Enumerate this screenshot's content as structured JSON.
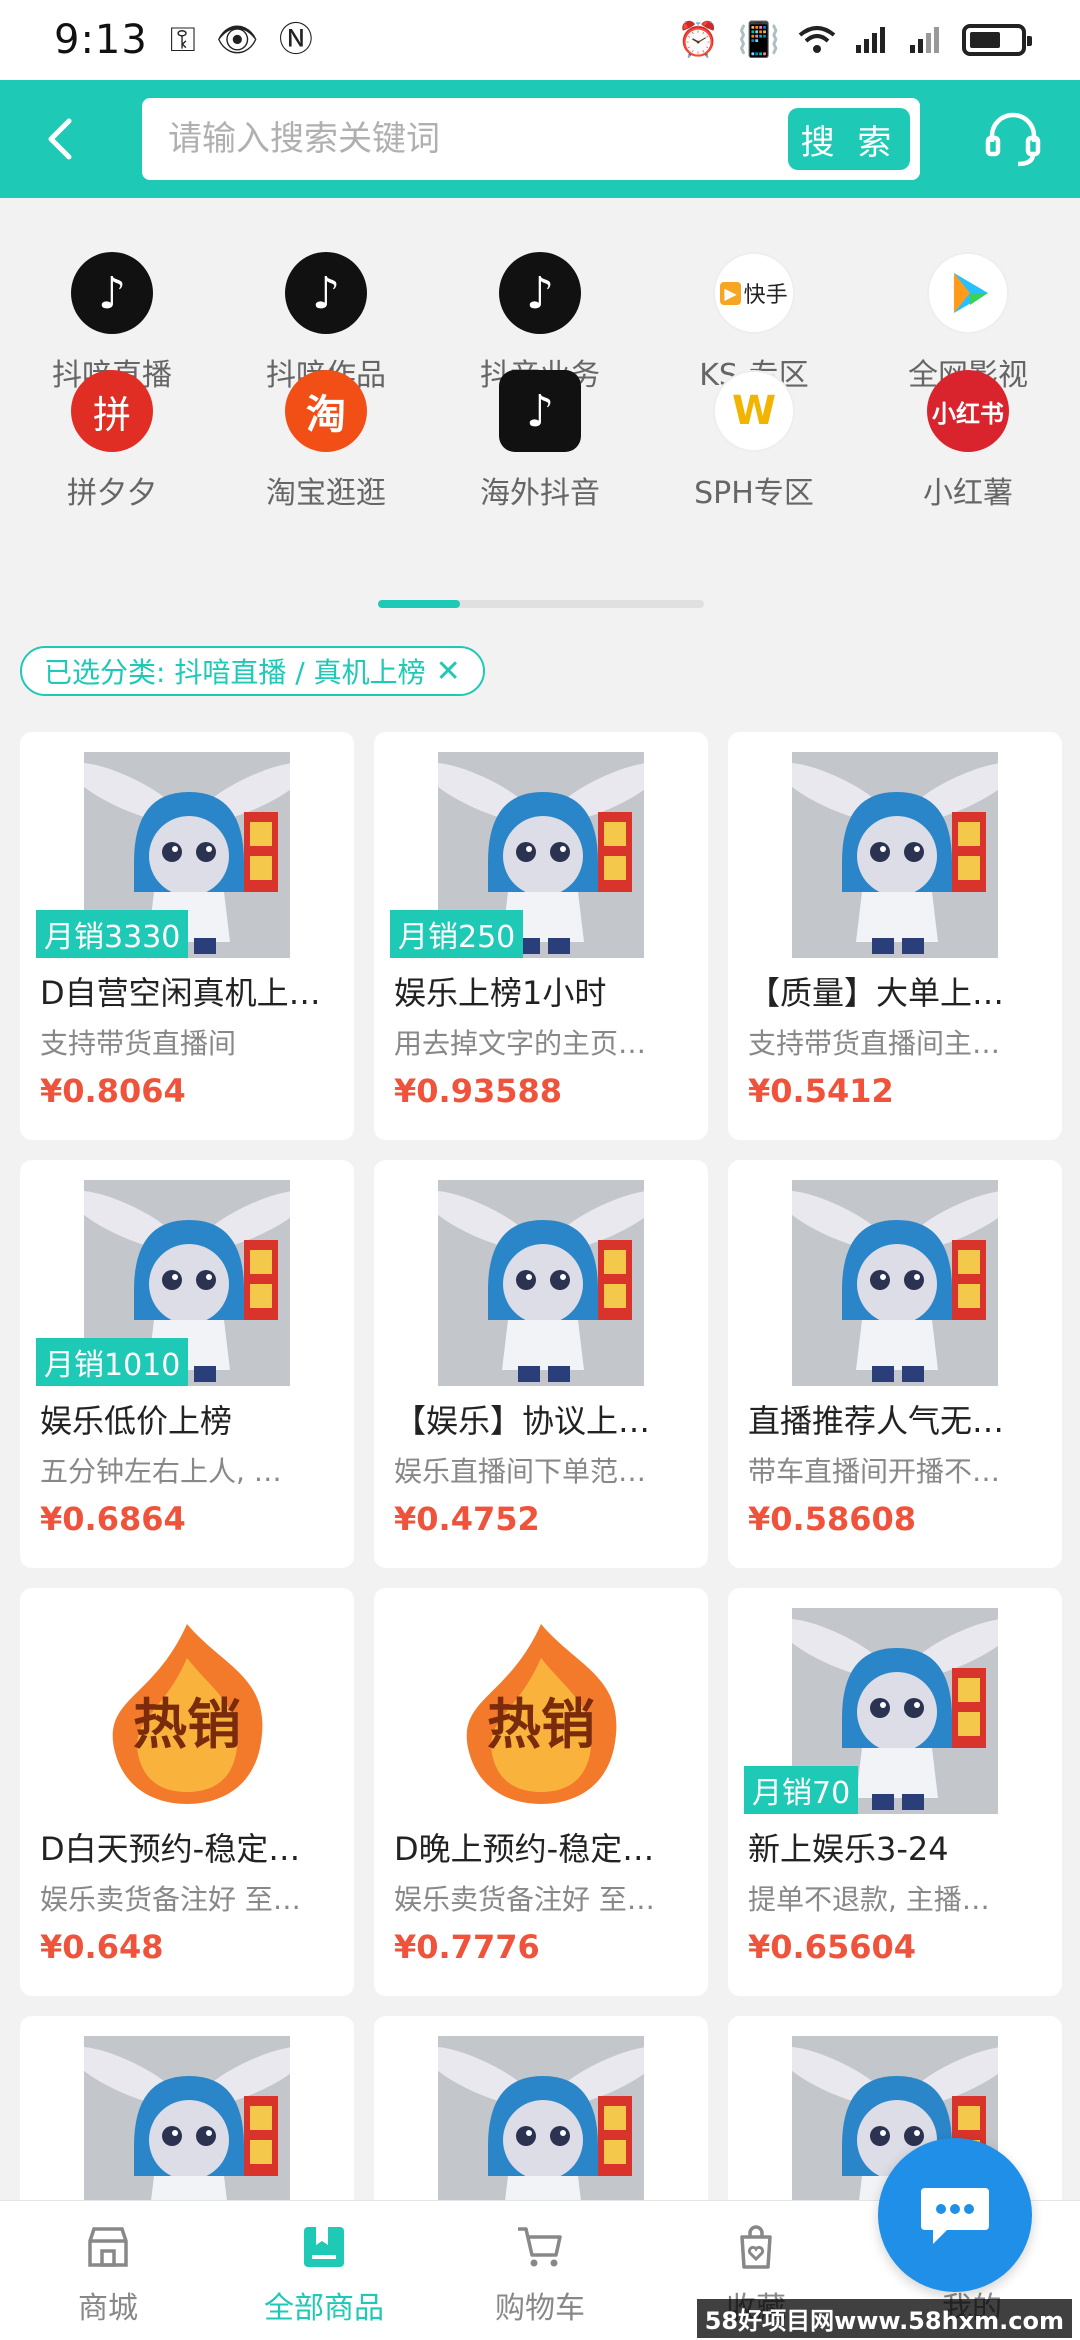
{
  "status_bar": {
    "time": "9:13"
  },
  "header": {
    "search_placeholder": "请输入搜索关键词",
    "search_button": "搜 索"
  },
  "categories": [
    {
      "label": "抖喑直播",
      "icon": "tiktok-icon"
    },
    {
      "label": "抖喑作品",
      "icon": "tiktok-icon"
    },
    {
      "label": "抖音业务",
      "icon": "tiktok-icon"
    },
    {
      "label": "KS-专区",
      "icon": "kuaishou-icon"
    },
    {
      "label": "全网影视",
      "icon": "tencent-video-icon"
    },
    {
      "label": "拼夕夕",
      "icon": "pinduoduo-icon"
    },
    {
      "label": "淘宝逛逛",
      "icon": "taobao-icon"
    },
    {
      "label": "海外抖音",
      "icon": "tiktok-overseas-icon"
    },
    {
      "label": "SPH专区",
      "icon": "channels-icon"
    },
    {
      "label": "小红薯",
      "icon": "xiaohongshu-icon"
    }
  ],
  "category_icon_text": {
    "tiktok": "♪",
    "kuaishou": "快手",
    "pdd": "拼",
    "taobao": "淘",
    "sph": "W",
    "xhs": "小红书"
  },
  "filter": {
    "label": "已选分类: 抖喑直播 / 真机上榜",
    "close": "✕"
  },
  "products": [
    {
      "title": "D自营空闲真机上…",
      "desc": "支持带货直播间",
      "price": "¥0.8064",
      "sales": "月销3330",
      "image": "rabbit"
    },
    {
      "title": "娱乐上榜1小时",
      "desc": "用去掉文字的主页…",
      "price": "¥0.93588",
      "sales": "月销250",
      "image": "rabbit"
    },
    {
      "title": "【质量】大单上…",
      "desc": "支持带货直播间主…",
      "price": "¥0.5412",
      "sales": "",
      "image": "rabbit"
    },
    {
      "title": "娱乐低价上榜",
      "desc": "五分钟左右上人, …",
      "price": "¥0.6864",
      "sales": "月销1010",
      "image": "rabbit"
    },
    {
      "title": "【娱乐】协议上…",
      "desc": "娱乐直播间下单范…",
      "price": "¥0.4752",
      "sales": "",
      "image": "rabbit"
    },
    {
      "title": "直播推荐人气无…",
      "desc": "带车直播间开播不…",
      "price": "¥0.58608",
      "sales": "",
      "image": "rabbit"
    },
    {
      "title": "D白天预约-稳定…",
      "desc": "娱乐卖货备注好 至…",
      "price": "¥0.648",
      "sales": "",
      "image": "hot"
    },
    {
      "title": "D晚上预约-稳定…",
      "desc": "娱乐卖货备注好 至…",
      "price": "¥0.7776",
      "sales": "",
      "image": "hot"
    },
    {
      "title": "新上娱乐3-24",
      "desc": "提单不退款, 主播…",
      "price": "¥0.65604",
      "sales": "月销70",
      "image": "rabbit"
    }
  ],
  "hot_label": "热销",
  "tabs": [
    {
      "label": "商城"
    },
    {
      "label": "全部商品"
    },
    {
      "label": "购物车"
    },
    {
      "label": "收藏"
    },
    {
      "label": "我的"
    }
  ],
  "watermark": "58好项目网www.58hxm.com",
  "colors": {
    "accent": "#1ec9b5",
    "price": "#f0533c",
    "fab": "#1f8fe8"
  }
}
